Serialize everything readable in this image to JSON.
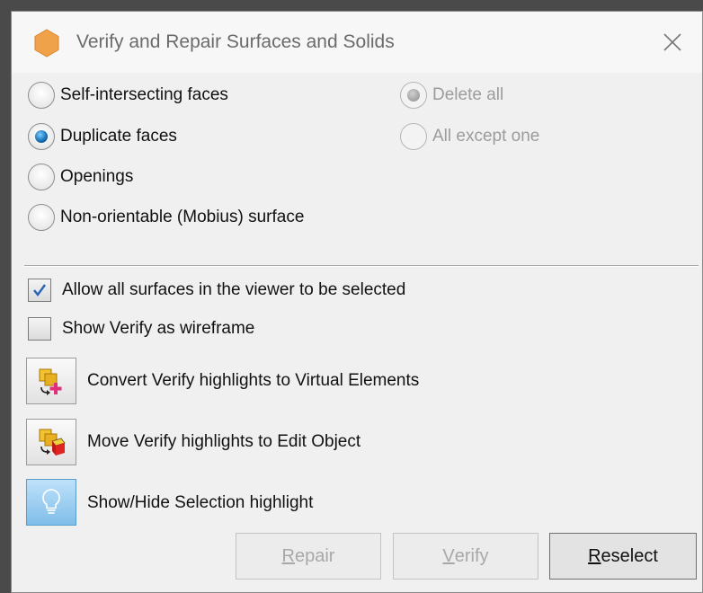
{
  "window": {
    "title": "Verify and Repair Surfaces and Solids",
    "accent": "#f0a24a"
  },
  "check_type": {
    "options": [
      {
        "label": "Self-intersecting faces",
        "checked": false
      },
      {
        "label": "Duplicate faces",
        "checked": true
      },
      {
        "label": "Openings",
        "checked": false
      },
      {
        "label": "Non-orientable (Mobius) surface",
        "checked": false
      }
    ]
  },
  "duplicate_mode": {
    "options": [
      {
        "label": "Delete all",
        "checked": true,
        "disabled": true
      },
      {
        "label": "All except one",
        "checked": false,
        "disabled": true
      }
    ]
  },
  "settings": {
    "allow_all_surfaces": {
      "label": "Allow all surfaces in the viewer to be selected",
      "checked": true
    },
    "show_wireframe": {
      "label": "Show Verify as wireframe",
      "checked": false
    }
  },
  "tools": [
    {
      "label": "Convert Verify highlights to Virtual Elements",
      "icon": "convert-virtual-icon"
    },
    {
      "label": "Move Verify highlights to Edit Object",
      "icon": "move-edit-object-icon"
    },
    {
      "label": "Show/Hide Selection highlight",
      "icon": "lightbulb-icon"
    }
  ],
  "buttons": {
    "repair": {
      "first": "R",
      "rest": "epair",
      "disabled": true
    },
    "verify": {
      "first": "V",
      "rest": "erify",
      "disabled": true
    },
    "reselect": {
      "first": "R",
      "rest": "eselect",
      "disabled": false
    }
  }
}
